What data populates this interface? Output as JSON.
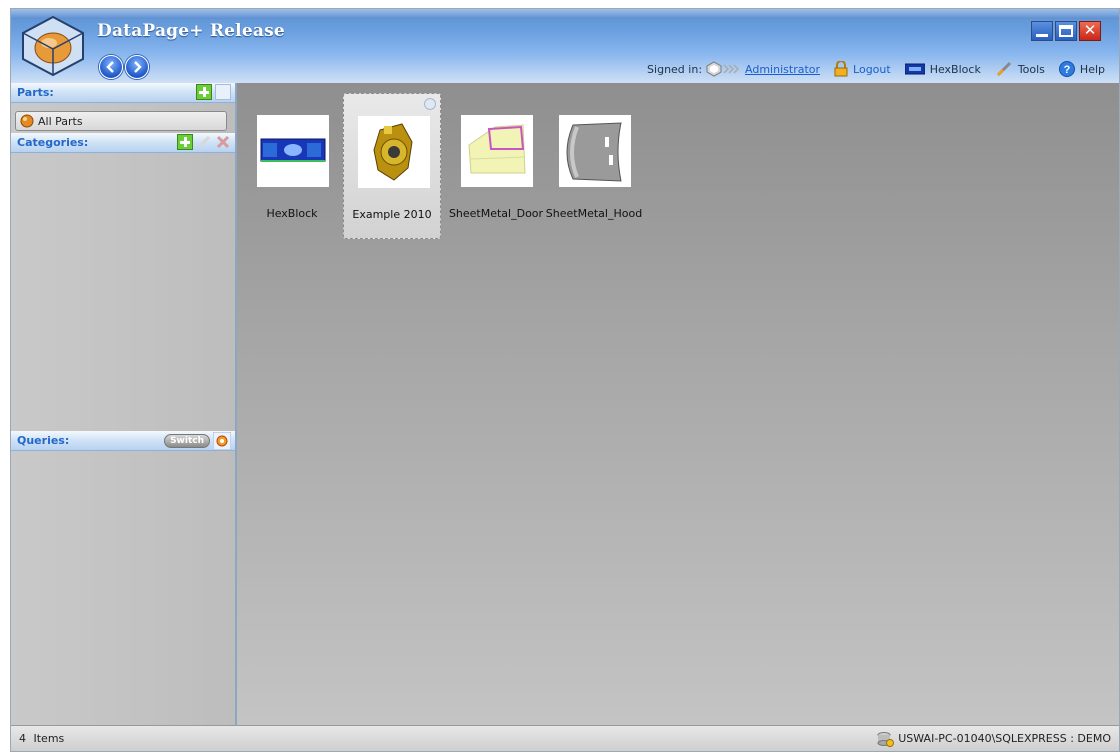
{
  "app": {
    "title": "DataPage+ Release"
  },
  "nav": {
    "back_icon": "arrow-left-icon",
    "forward_icon": "arrow-right-icon"
  },
  "window_controls": {
    "min_icon": "minimize-icon",
    "max_icon": "maximize-icon",
    "close_icon": "close-icon"
  },
  "userbar": {
    "signed_in_label": "Signed in:",
    "user": "Administrator",
    "logout": "Logout",
    "database": "HexBlock",
    "tools": "Tools",
    "help": "Help"
  },
  "sidebar": {
    "parts_header": "Parts:",
    "all_parts": "All Parts",
    "categories_header": "Categories:",
    "queries_header": "Queries:",
    "switch_label": "Switch"
  },
  "parts": [
    {
      "name": "HexBlock",
      "selected": false,
      "icon": "hexblock-thumbnail"
    },
    {
      "name": "Example 2010",
      "selected": true,
      "icon": "example-part-thumbnail"
    },
    {
      "name": "SheetMetal_Door",
      "selected": false,
      "icon": "door-thumbnail"
    },
    {
      "name": "SheetMetal_Hood",
      "selected": false,
      "icon": "hood-thumbnail"
    }
  ],
  "status": {
    "count": "4",
    "items_label": "Items",
    "connection": "USWAI-PC-01040\\SQLEXPRESS : DEMO"
  },
  "colors": {
    "accent": "#2468c8",
    "link": "#1a5fd0",
    "titlebar": "#6a9fe0"
  }
}
